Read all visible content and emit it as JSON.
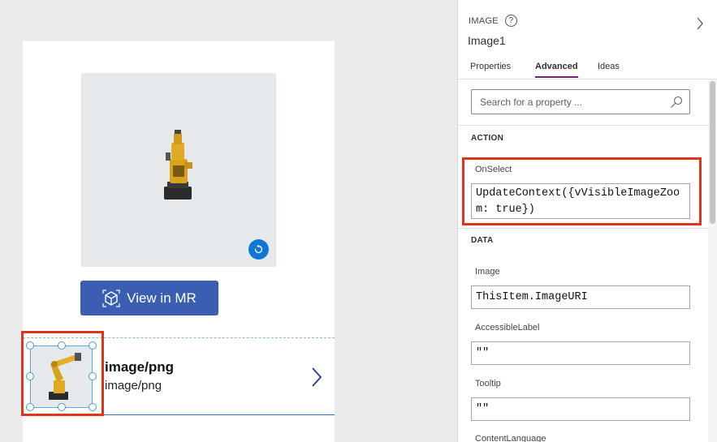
{
  "canvas": {
    "mr_button_label": "View in MR",
    "gallery_item": {
      "title": "image/png",
      "subtitle": "image/png"
    }
  },
  "panel": {
    "control_type": "IMAGE",
    "control_name": "Image1",
    "tabs": [
      {
        "label": "Properties",
        "active": false
      },
      {
        "label": "Advanced",
        "active": true
      },
      {
        "label": "Ideas",
        "active": false
      }
    ],
    "search_placeholder": "Search for a property ...",
    "sections": {
      "action": {
        "heading": "ACTION",
        "onselect_label": "OnSelect",
        "onselect_value": "UpdateContext({vVisibleImageZoom: true})"
      },
      "data": {
        "heading": "DATA",
        "image_label": "Image",
        "image_value": "ThisItem.ImageURI",
        "accessible_label": "AccessibleLabel",
        "accessible_value": "\"\"",
        "tooltip_label": "Tooltip",
        "tooltip_value": "\"\"",
        "content_language_label": "ContentLanguage"
      }
    }
  },
  "colors": {
    "accent_tab": "#742774",
    "highlight": "#e13418",
    "mr_button": "#3b5eb3",
    "selection": "#4f97db"
  },
  "icons": [
    "reset-view-icon",
    "mixed-reality-cube-icon",
    "chevron-right-icon",
    "help-icon",
    "collapse-panel-icon",
    "search-icon"
  ]
}
